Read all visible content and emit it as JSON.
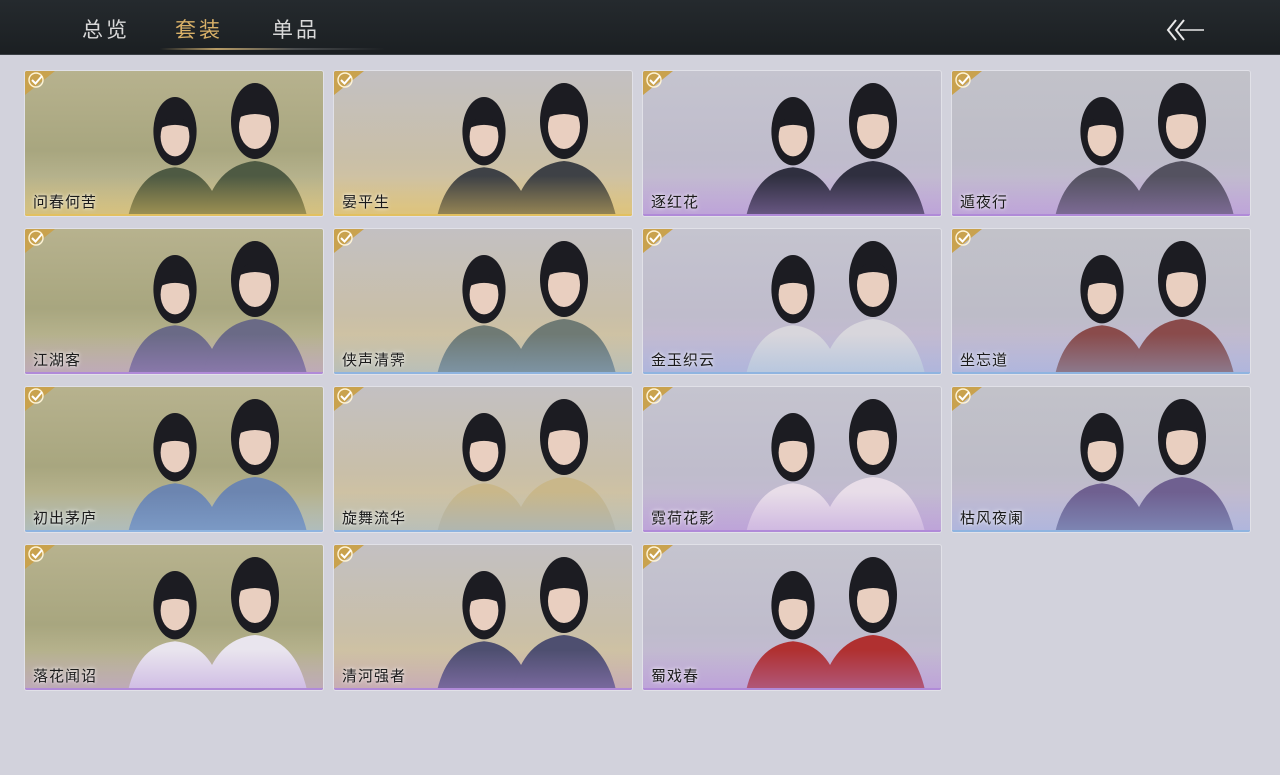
{
  "tabs": [
    {
      "label": "总览",
      "active": false
    },
    {
      "label": "套装",
      "active": true
    },
    {
      "label": "单品",
      "active": false
    }
  ],
  "back_icon": "double-chevron-left-arrow-icon",
  "check_icon": "check-corner-icon",
  "colors": {
    "gold_accent": "#d8b068",
    "tier_gold": "#e2c060",
    "tier_purple": "#b08ad8",
    "tier_blue": "#8fb4e0"
  },
  "outfits": [
    {
      "name": "问春何苦",
      "tier": "gold",
      "owned": true
    },
    {
      "name": "晏平生",
      "tier": "gold",
      "owned": true
    },
    {
      "name": "逐红花",
      "tier": "purple",
      "owned": true
    },
    {
      "name": "遁夜行",
      "tier": "purple",
      "owned": true
    },
    {
      "name": "江湖客",
      "tier": "purple",
      "owned": true
    },
    {
      "name": "侠声清霁",
      "tier": "blue",
      "owned": true
    },
    {
      "name": "金玉织云",
      "tier": "blue",
      "owned": true
    },
    {
      "name": "坐忘道",
      "tier": "blue",
      "owned": true
    },
    {
      "name": "初出茅庐",
      "tier": "blue",
      "owned": true
    },
    {
      "name": "旋舞流华",
      "tier": "blue",
      "owned": true
    },
    {
      "name": "霓荷花影",
      "tier": "purple",
      "owned": true
    },
    {
      "name": "枯风夜阑",
      "tier": "blue",
      "owned": true
    },
    {
      "name": "落花闻诏",
      "tier": "purple",
      "owned": true
    },
    {
      "name": "清河强者",
      "tier": "purple",
      "owned": true
    },
    {
      "name": "蜀戏春",
      "tier": "purple",
      "owned": true
    }
  ]
}
